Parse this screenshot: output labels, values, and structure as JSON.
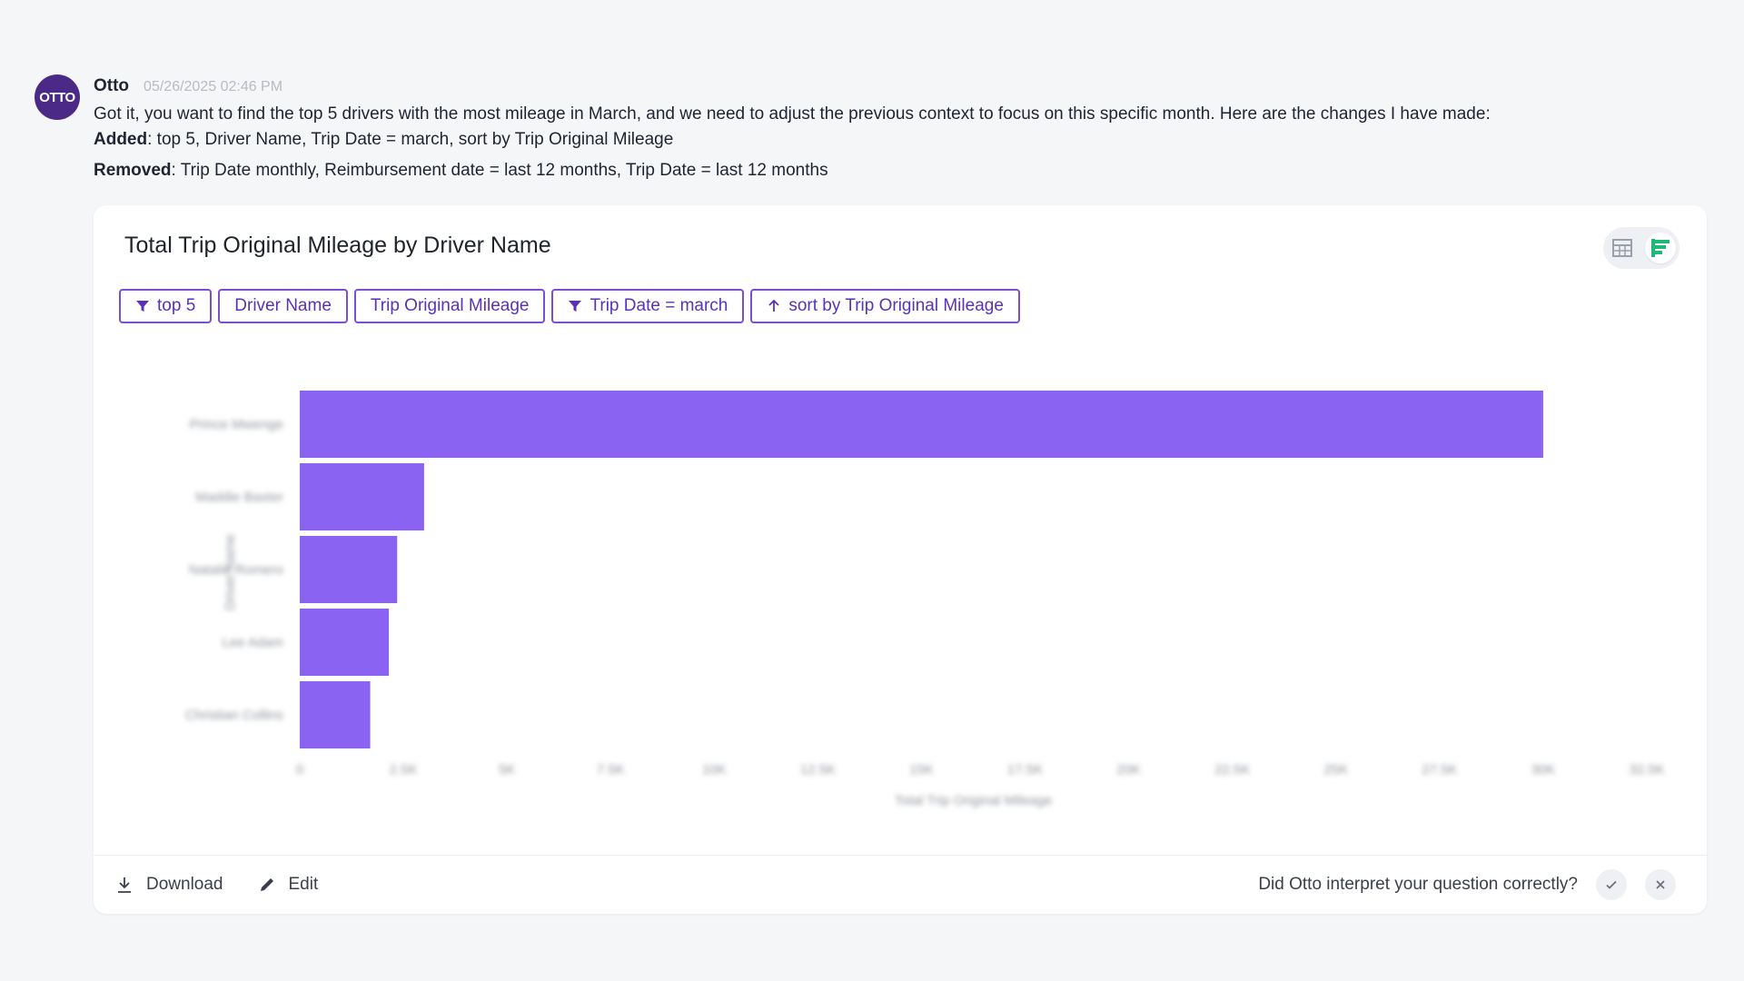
{
  "message": {
    "avatar_text": "OTTO",
    "sender": "Otto",
    "timestamp": "05/26/2025 02:46 PM",
    "text": "Got it, you want to find the top 5 drivers with the most mileage in March, and we need to adjust the previous context to focus on this specific month. Here are the changes I have made:",
    "added_label": "Added",
    "added_items": "top 5,  Driver Name,  Trip Date = march,  sort by Trip Original Mileage",
    "removed_label": "Removed",
    "removed_items": "Trip Date monthly,  Reimbursement date = last 12 months,  Trip Date = last 12 months"
  },
  "card": {
    "title": "Total Trip Original Mileage by Driver Name",
    "view_toggle": {
      "table_icon": "table-icon",
      "chart_icon": "bar-chart-icon",
      "active": "chart"
    },
    "chips": [
      {
        "label": "top 5",
        "icon": "filter-icon"
      },
      {
        "label": "Driver Name",
        "icon": ""
      },
      {
        "label": "Trip Original Mileage",
        "icon": ""
      },
      {
        "label": "Trip Date = march",
        "icon": "filter-icon"
      },
      {
        "label": "sort by Trip Original Mileage",
        "icon": "arrow-up-icon"
      }
    ],
    "footer": {
      "download_label": "Download",
      "edit_label": "Edit",
      "feedback_question": "Did Otto interpret your question correctly?"
    }
  },
  "chart_data": {
    "type": "bar",
    "orientation": "horizontal",
    "categories": [
      "Prince Mwenge",
      "Maddie Baxter",
      "Natalie Romero",
      "Lee Adam",
      "Christian Collins"
    ],
    "values": [
      30000,
      3000,
      2350,
      2150,
      1700
    ],
    "title": "",
    "xlabel": "Total Trip Original Mileage",
    "ylabel": "Driver Name",
    "xlim": [
      0,
      32500
    ],
    "xticks": [
      0,
      2500,
      5000,
      7500,
      10000,
      12500,
      15000,
      17500,
      20000,
      22500,
      25000,
      27500,
      30000,
      32500
    ],
    "xtick_labels": [
      "0",
      "2.5K",
      "5K",
      "7.5K",
      "10K",
      "12.5K",
      "15K",
      "17.5K",
      "20K",
      "22.5K",
      "25K",
      "27.5K",
      "30K",
      "32.5K"
    ],
    "bar_color": "#8b63f2",
    "grid": false,
    "legend": "none"
  },
  "colors": {
    "accent": "#7a4fd3",
    "bar": "#8b63f2",
    "avatar": "#4a2a86",
    "chart_icon_active": "#1fb877"
  }
}
